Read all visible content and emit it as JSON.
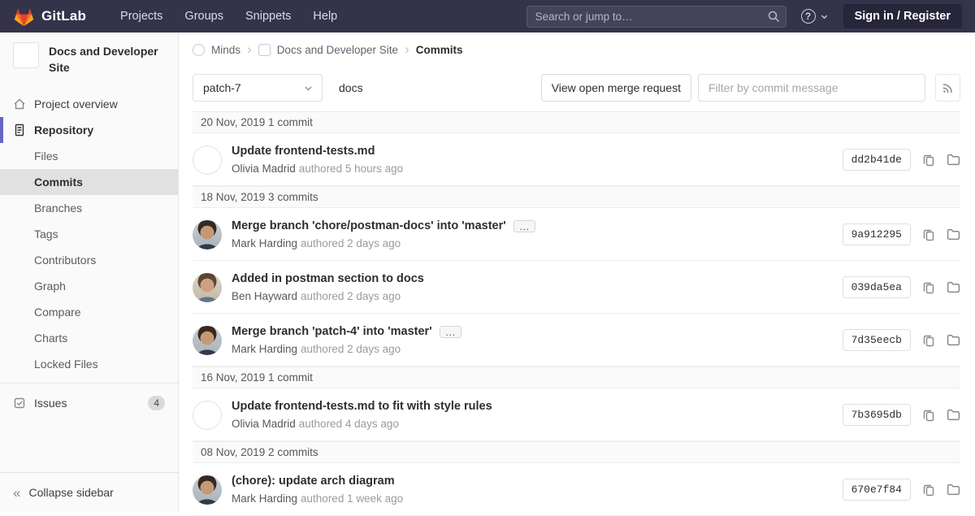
{
  "navbar": {
    "logo_label": "GitLab",
    "menu": [
      "Projects",
      "Groups",
      "Snippets",
      "Help"
    ],
    "search_placeholder": "Search or jump to…",
    "sign_in_label": "Sign in / Register"
  },
  "sidebar": {
    "project_title": "Docs and Developer Site",
    "project_overview_label": "Project overview",
    "repository_label": "Repository",
    "repo_subitems": [
      {
        "label": "Files",
        "active": false
      },
      {
        "label": "Commits",
        "active": true
      },
      {
        "label": "Branches",
        "active": false
      },
      {
        "label": "Tags",
        "active": false
      },
      {
        "label": "Contributors",
        "active": false
      },
      {
        "label": "Graph",
        "active": false
      },
      {
        "label": "Compare",
        "active": false
      },
      {
        "label": "Charts",
        "active": false
      },
      {
        "label": "Locked Files",
        "active": false
      }
    ],
    "issues_label": "Issues",
    "issues_count": "4",
    "collapse_label": "Collapse sidebar"
  },
  "breadcrumb": {
    "group": "Minds",
    "project": "Docs and Developer Site",
    "current": "Commits"
  },
  "controls": {
    "branch_selected": "patch-7",
    "path": "docs",
    "merge_request_button": "View open merge request",
    "filter_placeholder": "Filter by commit message"
  },
  "commits": {
    "groups": [
      {
        "date_header": "20 Nov, 2019 1 commit",
        "commits": [
          {
            "title": "Update frontend-tests.md",
            "author": "Olivia Madrid",
            "time": "authored 5 hours ago",
            "sha": "dd2b41de",
            "expandable": false,
            "avatar_style": "blank"
          }
        ]
      },
      {
        "date_header": "18 Nov, 2019 3 commits",
        "commits": [
          {
            "title": "Merge branch 'chore/postman-docs' into 'master'",
            "author": "Mark Harding",
            "time": "authored 2 days ago",
            "sha": "9a912295",
            "expandable": true,
            "avatar_style": "photo-a"
          },
          {
            "title": "Added in postman section to docs",
            "author": "Ben Hayward",
            "time": "authored 2 days ago",
            "sha": "039da5ea",
            "expandable": false,
            "avatar_style": "photo-b"
          },
          {
            "title": "Merge branch 'patch-4' into 'master'",
            "author": "Mark Harding",
            "time": "authored 2 days ago",
            "sha": "7d35eecb",
            "expandable": true,
            "avatar_style": "photo-a"
          }
        ]
      },
      {
        "date_header": "16 Nov, 2019 1 commit",
        "commits": [
          {
            "title": "Update frontend-tests.md to fit with style rules",
            "author": "Olivia Madrid",
            "time": "authored 4 days ago",
            "sha": "7b3695db",
            "expandable": false,
            "avatar_style": "blank"
          }
        ]
      },
      {
        "date_header": "08 Nov, 2019 2 commits",
        "commits": [
          {
            "title": "(chore): update arch diagram",
            "author": "Mark Harding",
            "time": "authored 1 week ago",
            "sha": "670e7f84",
            "expandable": false,
            "avatar_style": "photo-a"
          }
        ]
      }
    ]
  },
  "icons": {
    "ellipsis_glyph": "…",
    "chevron_glyph": "›",
    "collapse_glyph": "«",
    "help_glyph": "?"
  }
}
